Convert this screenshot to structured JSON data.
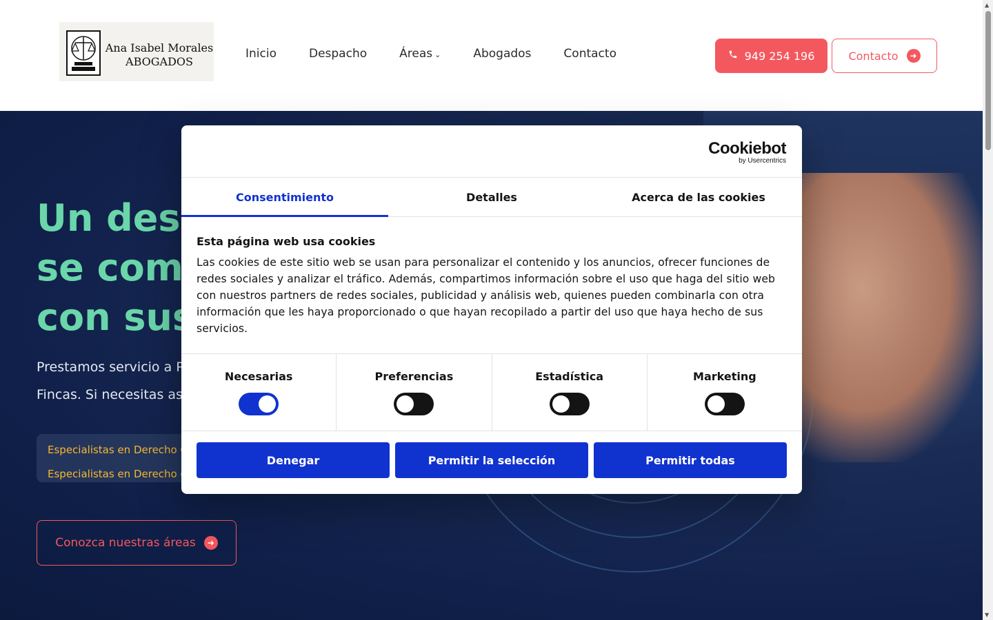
{
  "header": {
    "logo": {
      "line1": "Ana Isabel Morales",
      "line2": "ABOGADOS"
    },
    "nav": [
      {
        "label": "Inicio"
      },
      {
        "label": "Despacho"
      },
      {
        "label": "Áreas"
      },
      {
        "label": "Abogados"
      },
      {
        "label": "Contacto"
      }
    ],
    "phone_button": "949 254 196",
    "contact_button": "Contacto"
  },
  "hero": {
    "title_lines": [
      "Un desp",
      "se comp",
      "con sus c"
    ],
    "subtitle_lines": [
      "Prestamos servicio a P",
      "Fincas. Si necesitas ase"
    ],
    "specialties": [
      "Especialistas en Derecho C",
      "Especialistas en Derecho d"
    ],
    "areas_button": "Conozca nuestras áreas"
  },
  "cookie_dialog": {
    "brand": "Cookiebot",
    "brand_sub": "by Usercentrics",
    "tabs": [
      "Consentimiento",
      "Detalles",
      "Acerca de las cookies"
    ],
    "active_tab": "Consentimiento",
    "title": "Esta página web usa cookies",
    "body": "Las cookies de este sitio web se usan para personalizar el contenido y los anuncios, ofrecer funciones de redes sociales y analizar el tráfico. Además, compartimos información sobre el uso que haga del sitio web con nuestros partners de redes sociales, publicidad y análisis web, quienes pueden combinarla con otra información que les haya proporcionado o que hayan recopilado a partir del uso que haya hecho de sus servicios.",
    "categories": [
      {
        "label": "Necesarias",
        "enabled": true
      },
      {
        "label": "Preferencias",
        "enabled": false
      },
      {
        "label": "Estadística",
        "enabled": false
      },
      {
        "label": "Marketing",
        "enabled": false
      }
    ],
    "buttons": {
      "deny": "Denegar",
      "allow_selection": "Permitir la selección",
      "allow_all": "Permitir todas"
    }
  },
  "colors": {
    "accent_red": "#f4585f",
    "hero_green": "#6ad6aa",
    "cookiebot_blue": "#1032cf",
    "specialty_yellow": "#f7b731"
  },
  "icons": [
    "phone-icon",
    "arrow-right-circle-icon",
    "chevron-down-icon",
    "scales-of-justice-icon"
  ]
}
